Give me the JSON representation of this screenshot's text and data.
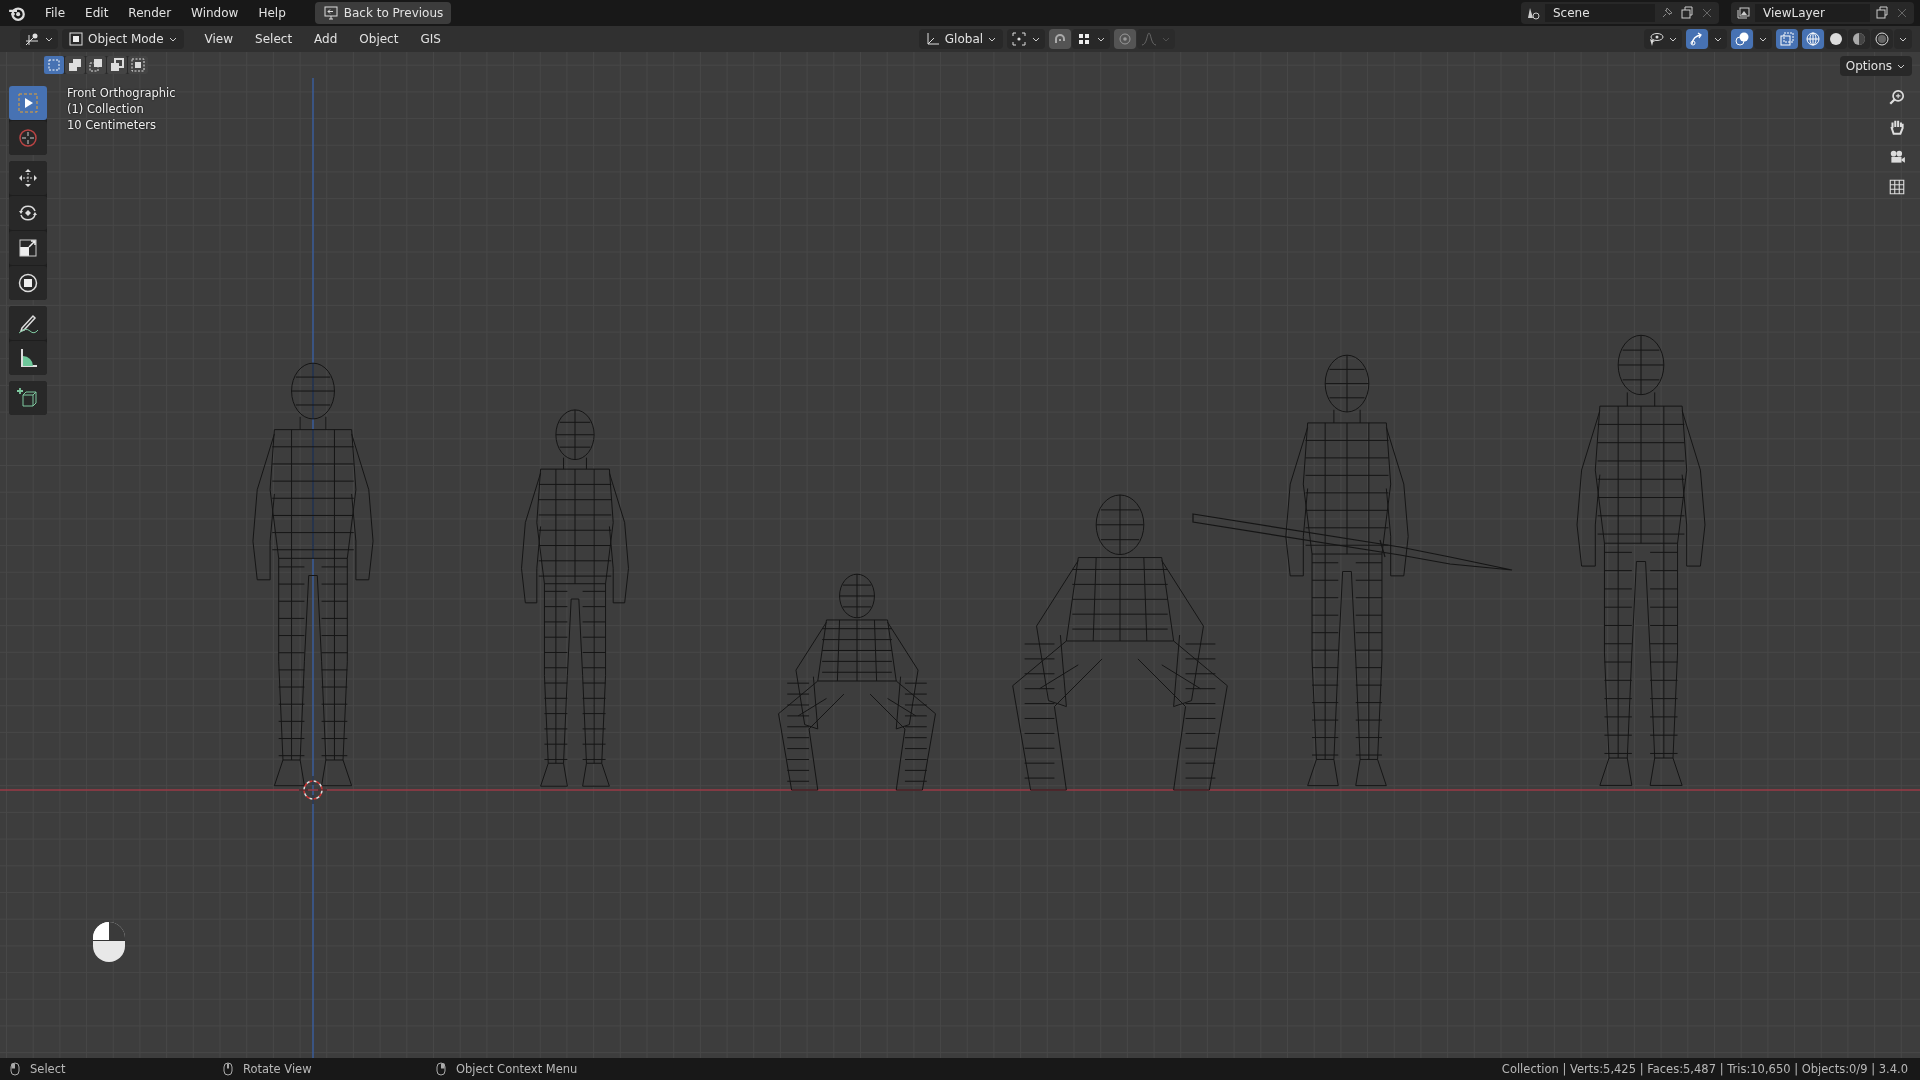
{
  "menu_bar": {
    "items": [
      "File",
      "Edit",
      "Render",
      "Window",
      "Help"
    ],
    "back_button": "Back to Previous"
  },
  "scene": {
    "name": "Scene"
  },
  "view_layer": {
    "name": "ViewLayer"
  },
  "header": {
    "mode": "Object Mode",
    "menus": [
      "View",
      "Select",
      "Add",
      "Object",
      "GIS"
    ],
    "orientation": "Global",
    "toggles": [
      {
        "kind": "gizmos",
        "on": true
      },
      {
        "kind": "overlays",
        "on": true
      },
      {
        "kind": "xray",
        "on": true
      }
    ],
    "shading": [
      {
        "kind": "wireframe",
        "selected": true
      },
      {
        "kind": "solid",
        "selected": false
      },
      {
        "kind": "material",
        "selected": false
      },
      {
        "kind": "rendered",
        "selected": false
      }
    ],
    "options": "Options"
  },
  "select_modes": [
    {
      "kind": "new",
      "selected": true
    },
    {
      "kind": "extend",
      "selected": false
    },
    {
      "kind": "subtract",
      "selected": false
    },
    {
      "kind": "invert",
      "selected": false
    },
    {
      "kind": "intersect",
      "selected": false
    }
  ],
  "toolbar": [
    {
      "tools": [
        {
          "kind": "select",
          "selected": true
        },
        {
          "kind": "cursor",
          "selected": false
        }
      ]
    },
    {
      "tools": [
        {
          "kind": "move",
          "selected": false
        },
        {
          "kind": "rotate",
          "selected": false
        },
        {
          "kind": "scale",
          "selected": false
        },
        {
          "kind": "transform",
          "selected": false
        }
      ]
    },
    {
      "tools": [
        {
          "kind": "annotate",
          "selected": false
        },
        {
          "kind": "measure",
          "selected": false
        }
      ]
    },
    {
      "tools": [
        {
          "kind": "add_cube",
          "selected": false
        }
      ]
    }
  ],
  "viewport": {
    "info": [
      "Front Orthographic",
      "(1) Collection",
      "10 Centimeters"
    ]
  },
  "status_bar": {
    "hints": [
      "Select",
      "Rotate View",
      "Object Context Menu"
    ],
    "stats": "Collection | Verts:5,425 | Faces:5,487 | Tris:10,650 | Objects:0/9 | 3.4.0"
  }
}
